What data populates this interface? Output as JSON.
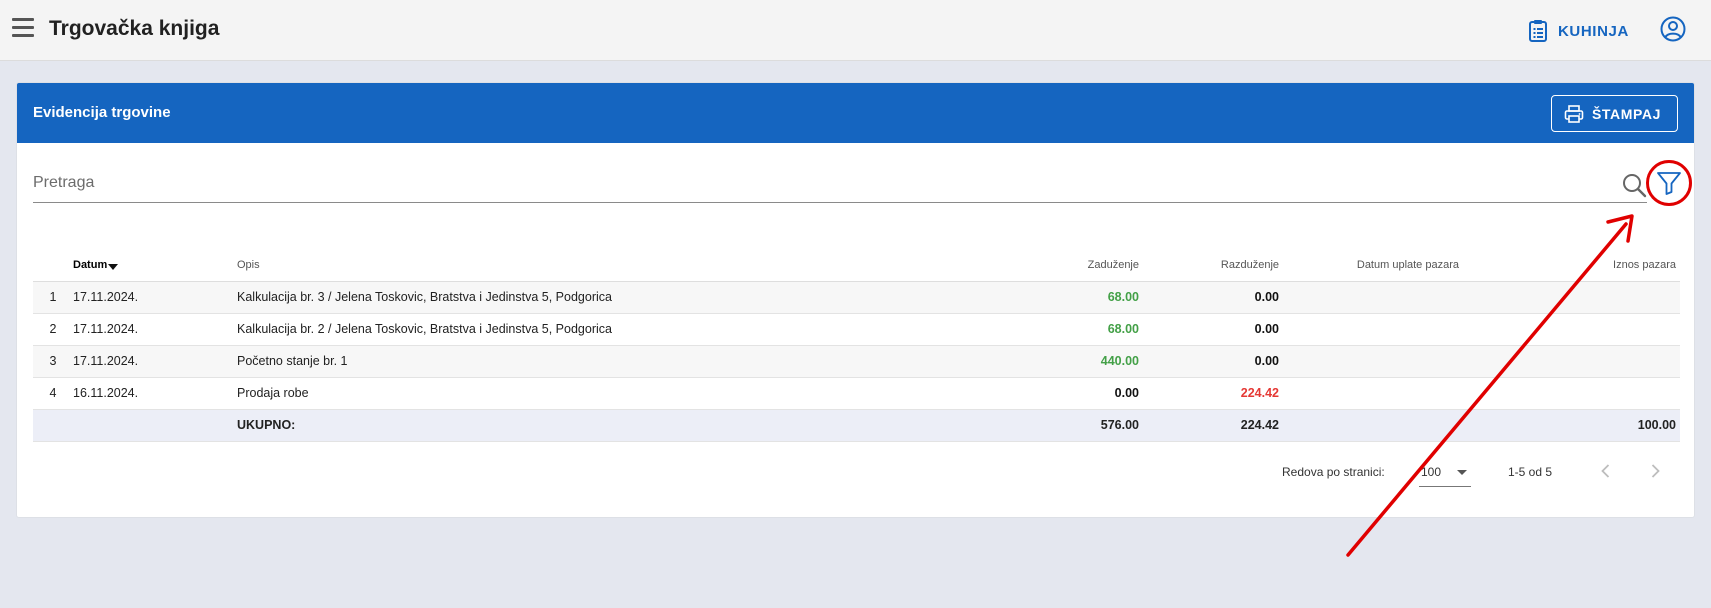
{
  "appbar": {
    "title": "Trgovačka knjiga",
    "kitchen_label": "KUHINJA"
  },
  "card": {
    "title": "Evidencija trgovine",
    "print_label": "ŠTAMPAJ"
  },
  "search": {
    "placeholder": "Pretraga"
  },
  "table": {
    "columns": {
      "datum": "Datum",
      "opis": "Opis",
      "zaduzenje": "Zaduženje",
      "razduzenje": "Razduženje",
      "datum_uplate": "Datum uplate pazara",
      "iznos": "Iznos pazara"
    },
    "rows": [
      {
        "idx": "1",
        "datum": "17.11.2024.",
        "opis": "Kalkulacija br. 3 / Jelena Toskovic, Bratstva i Jedinstva 5, Podgorica",
        "zaduzenje": "68.00",
        "razduzenje": "0.00",
        "datum_uplate": "",
        "iznos": ""
      },
      {
        "idx": "2",
        "datum": "17.11.2024.",
        "opis": "Kalkulacija br. 2 / Jelena Toskovic, Bratstva i Jedinstva 5, Podgorica",
        "zaduzenje": "68.00",
        "razduzenje": "0.00",
        "datum_uplate": "",
        "iznos": ""
      },
      {
        "idx": "3",
        "datum": "17.11.2024.",
        "opis": "Početno stanje br. 1",
        "zaduzenje": "440.00",
        "razduzenje": "0.00",
        "datum_uplate": "",
        "iznos": ""
      },
      {
        "idx": "4",
        "datum": "16.11.2024.",
        "opis": "Prodaja robe",
        "zaduzenje": "0.00",
        "razduzenje": "224.42",
        "datum_uplate": "",
        "iznos": ""
      }
    ],
    "total": {
      "label": "UKUPNO:",
      "zaduzenje": "576.00",
      "razduzenje": "224.42",
      "iznos": "100.00"
    }
  },
  "pager": {
    "rows_label": "Redova po stranici:",
    "rows_value": "100",
    "range": "1-5 od 5"
  },
  "colors": {
    "primary": "#1565c0",
    "positive": "#43a047",
    "negative": "#e53935",
    "annotation": "#e00000"
  }
}
